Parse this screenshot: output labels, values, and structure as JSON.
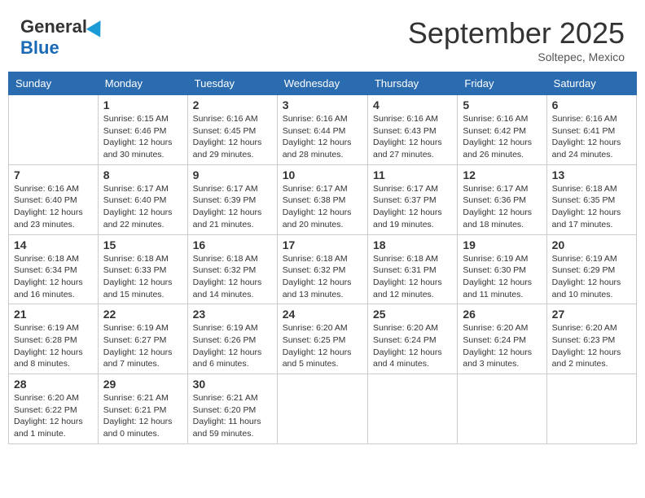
{
  "header": {
    "logo_general": "General",
    "logo_blue": "Blue",
    "month": "September 2025",
    "location": "Soltepec, Mexico"
  },
  "days_of_week": [
    "Sunday",
    "Monday",
    "Tuesday",
    "Wednesday",
    "Thursday",
    "Friday",
    "Saturday"
  ],
  "weeks": [
    [
      {
        "day": "",
        "info": ""
      },
      {
        "day": "1",
        "info": "Sunrise: 6:15 AM\nSunset: 6:46 PM\nDaylight: 12 hours\nand 30 minutes."
      },
      {
        "day": "2",
        "info": "Sunrise: 6:16 AM\nSunset: 6:45 PM\nDaylight: 12 hours\nand 29 minutes."
      },
      {
        "day": "3",
        "info": "Sunrise: 6:16 AM\nSunset: 6:44 PM\nDaylight: 12 hours\nand 28 minutes."
      },
      {
        "day": "4",
        "info": "Sunrise: 6:16 AM\nSunset: 6:43 PM\nDaylight: 12 hours\nand 27 minutes."
      },
      {
        "day": "5",
        "info": "Sunrise: 6:16 AM\nSunset: 6:42 PM\nDaylight: 12 hours\nand 26 minutes."
      },
      {
        "day": "6",
        "info": "Sunrise: 6:16 AM\nSunset: 6:41 PM\nDaylight: 12 hours\nand 24 minutes."
      }
    ],
    [
      {
        "day": "7",
        "info": "Sunrise: 6:16 AM\nSunset: 6:40 PM\nDaylight: 12 hours\nand 23 minutes."
      },
      {
        "day": "8",
        "info": "Sunrise: 6:17 AM\nSunset: 6:40 PM\nDaylight: 12 hours\nand 22 minutes."
      },
      {
        "day": "9",
        "info": "Sunrise: 6:17 AM\nSunset: 6:39 PM\nDaylight: 12 hours\nand 21 minutes."
      },
      {
        "day": "10",
        "info": "Sunrise: 6:17 AM\nSunset: 6:38 PM\nDaylight: 12 hours\nand 20 minutes."
      },
      {
        "day": "11",
        "info": "Sunrise: 6:17 AM\nSunset: 6:37 PM\nDaylight: 12 hours\nand 19 minutes."
      },
      {
        "day": "12",
        "info": "Sunrise: 6:17 AM\nSunset: 6:36 PM\nDaylight: 12 hours\nand 18 minutes."
      },
      {
        "day": "13",
        "info": "Sunrise: 6:18 AM\nSunset: 6:35 PM\nDaylight: 12 hours\nand 17 minutes."
      }
    ],
    [
      {
        "day": "14",
        "info": "Sunrise: 6:18 AM\nSunset: 6:34 PM\nDaylight: 12 hours\nand 16 minutes."
      },
      {
        "day": "15",
        "info": "Sunrise: 6:18 AM\nSunset: 6:33 PM\nDaylight: 12 hours\nand 15 minutes."
      },
      {
        "day": "16",
        "info": "Sunrise: 6:18 AM\nSunset: 6:32 PM\nDaylight: 12 hours\nand 14 minutes."
      },
      {
        "day": "17",
        "info": "Sunrise: 6:18 AM\nSunset: 6:32 PM\nDaylight: 12 hours\nand 13 minutes."
      },
      {
        "day": "18",
        "info": "Sunrise: 6:18 AM\nSunset: 6:31 PM\nDaylight: 12 hours\nand 12 minutes."
      },
      {
        "day": "19",
        "info": "Sunrise: 6:19 AM\nSunset: 6:30 PM\nDaylight: 12 hours\nand 11 minutes."
      },
      {
        "day": "20",
        "info": "Sunrise: 6:19 AM\nSunset: 6:29 PM\nDaylight: 12 hours\nand 10 minutes."
      }
    ],
    [
      {
        "day": "21",
        "info": "Sunrise: 6:19 AM\nSunset: 6:28 PM\nDaylight: 12 hours\nand 8 minutes."
      },
      {
        "day": "22",
        "info": "Sunrise: 6:19 AM\nSunset: 6:27 PM\nDaylight: 12 hours\nand 7 minutes."
      },
      {
        "day": "23",
        "info": "Sunrise: 6:19 AM\nSunset: 6:26 PM\nDaylight: 12 hours\nand 6 minutes."
      },
      {
        "day": "24",
        "info": "Sunrise: 6:20 AM\nSunset: 6:25 PM\nDaylight: 12 hours\nand 5 minutes."
      },
      {
        "day": "25",
        "info": "Sunrise: 6:20 AM\nSunset: 6:24 PM\nDaylight: 12 hours\nand 4 minutes."
      },
      {
        "day": "26",
        "info": "Sunrise: 6:20 AM\nSunset: 6:24 PM\nDaylight: 12 hours\nand 3 minutes."
      },
      {
        "day": "27",
        "info": "Sunrise: 6:20 AM\nSunset: 6:23 PM\nDaylight: 12 hours\nand 2 minutes."
      }
    ],
    [
      {
        "day": "28",
        "info": "Sunrise: 6:20 AM\nSunset: 6:22 PM\nDaylight: 12 hours\nand 1 minute."
      },
      {
        "day": "29",
        "info": "Sunrise: 6:21 AM\nSunset: 6:21 PM\nDaylight: 12 hours\nand 0 minutes."
      },
      {
        "day": "30",
        "info": "Sunrise: 6:21 AM\nSunset: 6:20 PM\nDaylight: 11 hours\nand 59 minutes."
      },
      {
        "day": "",
        "info": ""
      },
      {
        "day": "",
        "info": ""
      },
      {
        "day": "",
        "info": ""
      },
      {
        "day": "",
        "info": ""
      }
    ]
  ]
}
